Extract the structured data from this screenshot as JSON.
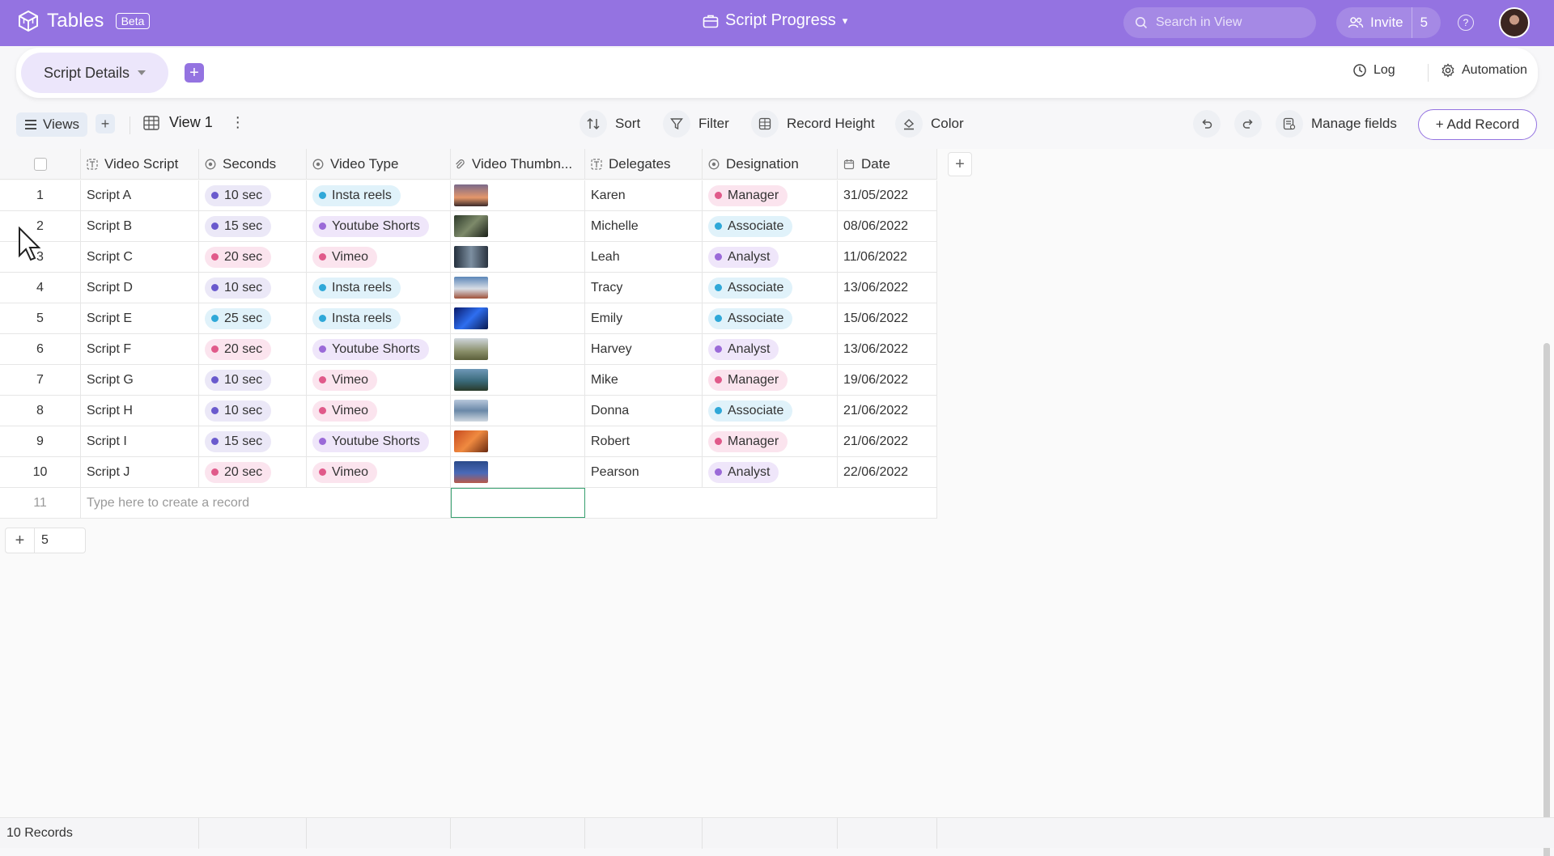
{
  "app": {
    "name": "Tables",
    "badge": "Beta"
  },
  "project": {
    "title": "Script Progress",
    "caret": "▾"
  },
  "search": {
    "placeholder": "Search in View"
  },
  "invite": {
    "label": "Invite",
    "count": "5"
  },
  "help": {
    "label": "?"
  },
  "sheet": {
    "name": "Script Details",
    "add": "+"
  },
  "header_actions": {
    "log": "Log",
    "automation": "Automation"
  },
  "toolbar": {
    "views": "Views",
    "view_add": "+",
    "view_name": "View 1",
    "kebab": "⋮",
    "sort": "Sort",
    "filter": "Filter",
    "record_height": "Record Height",
    "color": "Color",
    "manage_fields": "Manage fields",
    "add_record": "+ Add Record"
  },
  "columns": [
    {
      "label": "Video Script",
      "icon": "text-field-icon"
    },
    {
      "label": "Seconds",
      "icon": "single-select-icon"
    },
    {
      "label": "Video Type",
      "icon": "single-select-icon"
    },
    {
      "label": "Video Thumbn...",
      "icon": "attachment-icon"
    },
    {
      "label": "Delegates",
      "icon": "text-field-icon"
    },
    {
      "label": "Designation",
      "icon": "single-select-icon"
    },
    {
      "label": "Date",
      "icon": "calendar-icon"
    }
  ],
  "rows": [
    {
      "n": "1",
      "script": "Script A",
      "seconds": "10 sec",
      "type": "Insta reels",
      "thumb": "sunset-photo",
      "delegate": "Karen",
      "designation": "Manager",
      "date": "31/05/2022"
    },
    {
      "n": "2",
      "script": "Script B",
      "seconds": "15 sec",
      "type": "Youtube Shorts",
      "thumb": "forest-photo",
      "delegate": "Michelle",
      "designation": "Associate",
      "date": "08/06/2022"
    },
    {
      "n": "3",
      "script": "Script C",
      "seconds": "20 sec",
      "type": "Vimeo",
      "thumb": "trees-photo",
      "delegate": "Leah",
      "designation": "Analyst",
      "date": "11/06/2022"
    },
    {
      "n": "4",
      "script": "Script D",
      "seconds": "10 sec",
      "type": "Insta reels",
      "thumb": "mountain-photo",
      "delegate": "Tracy",
      "designation": "Associate",
      "date": "13/06/2022"
    },
    {
      "n": "5",
      "script": "Script E",
      "seconds": "25 sec",
      "type": "Insta reels",
      "thumb": "blue-light-photo",
      "delegate": "Emily",
      "designation": "Associate",
      "date": "15/06/2022"
    },
    {
      "n": "6",
      "script": "Script F",
      "seconds": "20 sec",
      "type": "Youtube Shorts",
      "thumb": "field-photo",
      "delegate": "Harvey",
      "designation": "Analyst",
      "date": "13/06/2022"
    },
    {
      "n": "7",
      "script": "Script G",
      "seconds": "10 sec",
      "type": "Vimeo",
      "thumb": "lake-photo",
      "delegate": "Mike",
      "designation": "Manager",
      "date": "19/06/2022"
    },
    {
      "n": "8",
      "script": "Script H",
      "seconds": "10 sec",
      "type": "Vimeo",
      "thumb": "coast-photo",
      "delegate": "Donna",
      "designation": "Associate",
      "date": "21/06/2022"
    },
    {
      "n": "9",
      "script": "Script I",
      "seconds": "15 sec",
      "type": "Youtube Shorts",
      "thumb": "arch-photo",
      "delegate": "Robert",
      "designation": "Manager",
      "date": "21/06/2022"
    },
    {
      "n": "10",
      "script": "Script J",
      "seconds": "20 sec",
      "type": "Vimeo",
      "thumb": "dusk-photo",
      "delegate": "Pearson",
      "designation": "Analyst",
      "date": "22/06/2022"
    }
  ],
  "new_row": {
    "n": "11",
    "placeholder": "Type here to create a record"
  },
  "bulk_add": {
    "plus": "+",
    "count": "5"
  },
  "footer": {
    "records": "10 Records"
  },
  "colors": {
    "accent": "#9473e1",
    "seconds": {
      "10 sec": "#6a5acd",
      "15 sec": "#6a5acd",
      "20 sec": "#e05a8a",
      "25 sec": "#2fa8d8"
    },
    "seconds_bg": {
      "10 sec": "#ebe8f7",
      "15 sec": "#ebe8f7",
      "20 sec": "#fbe4ee",
      "25 sec": "#e0f2fa"
    },
    "type": {
      "Insta reels": "#2fa8d8",
      "Youtube Shorts": "#9b6ad8",
      "Vimeo": "#e05a8a"
    },
    "type_bg": {
      "Insta reels": "#e0f2fa",
      "Youtube Shorts": "#efe6fa",
      "Vimeo": "#fbe4ee"
    },
    "designation": {
      "Manager": "#e05a8a",
      "Associate": "#2fa8d8",
      "Analyst": "#9b6ad8"
    },
    "designation_bg": {
      "Manager": "#fbe4ee",
      "Associate": "#e0f2fa",
      "Analyst": "#efe6fa"
    },
    "thumbs": {
      "sunset-photo": "linear-gradient(180deg,#7b6a8a,#e5976a 60%,#3a2a2a)",
      "forest-photo": "linear-gradient(135deg,#2d3a2a,#7d8a6a,#1a1f18)",
      "trees-photo": "linear-gradient(90deg,#24303d,#7d8fa1,#2a3440)",
      "mountain-photo": "linear-gradient(180deg,#5b86b8,#d8dde5 55%,#a0523a)",
      "blue-light-photo": "linear-gradient(135deg,#0a1a6a,#2e6ef0,#0a1a50)",
      "field-photo": "linear-gradient(180deg,#cfd6dc,#8a8f6a 60%,#5b5f3a)",
      "lake-photo": "linear-gradient(180deg,#6f98b8,#3a6a7a 55%,#2a3a2a)",
      "coast-photo": "linear-gradient(180deg,#b8c8dc,#6a88a8 50%,#d0d8e0)",
      "arch-photo": "linear-gradient(135deg,#c64a20,#f08a40,#6a2a10)",
      "dusk-photo": "linear-gradient(180deg,#2a4a8a,#4a6ab8 55%,#b85a4a)"
    }
  }
}
